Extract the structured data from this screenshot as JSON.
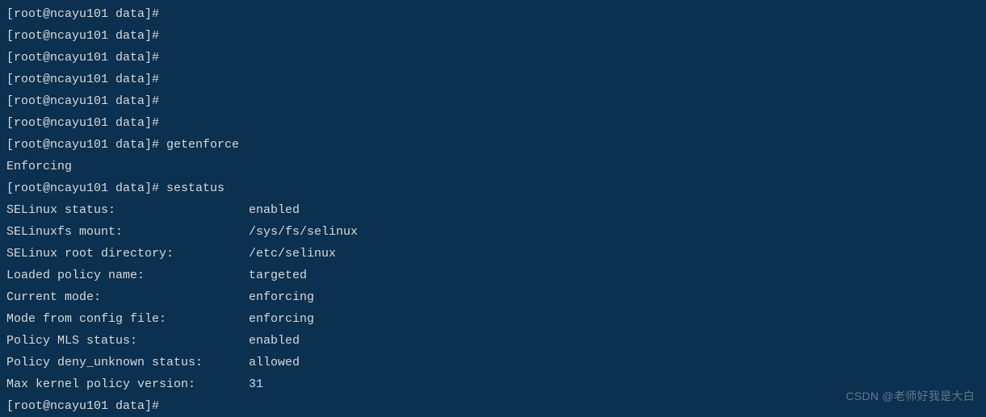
{
  "prompt": "[root@ncayu101 data]#",
  "empty_prompts_count": 6,
  "commands": {
    "getenforce": {
      "cmd": "getenforce",
      "output": "Enforcing"
    },
    "sestatus": {
      "cmd": "sestatus",
      "rows": [
        {
          "label": "SELinux status:",
          "value": "enabled"
        },
        {
          "label": "SELinuxfs mount:",
          "value": "/sys/fs/selinux"
        },
        {
          "label": "SELinux root directory:",
          "value": "/etc/selinux"
        },
        {
          "label": "Loaded policy name:",
          "value": "targeted"
        },
        {
          "label": "Current mode:",
          "value": "enforcing"
        },
        {
          "label": "Mode from config file:",
          "value": "enforcing"
        },
        {
          "label": "Policy MLS status:",
          "value": "enabled"
        },
        {
          "label": "Policy deny_unknown status:",
          "value": "allowed"
        },
        {
          "label": "Max kernel policy version:",
          "value": "31"
        }
      ]
    }
  },
  "watermark": "CSDN @老师好我是大白"
}
